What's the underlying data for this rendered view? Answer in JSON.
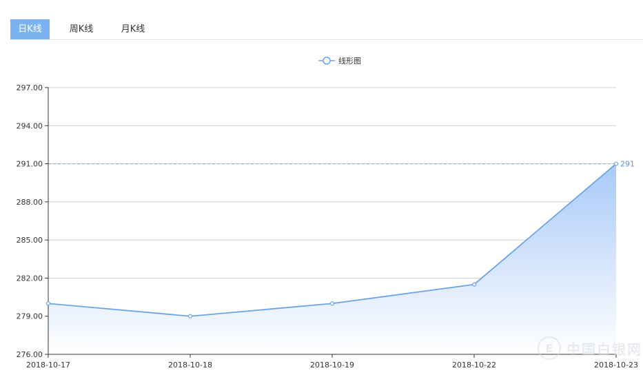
{
  "tabs": [
    {
      "label": "日K线",
      "active": true
    },
    {
      "label": "周K线",
      "active": false
    },
    {
      "label": "月K线",
      "active": false
    }
  ],
  "legend": {
    "label": "线形图",
    "icon": "circle-line-icon"
  },
  "watermark": {
    "text": "中国白银网",
    "icon": "logo-icon"
  },
  "colors": {
    "line": "#6aa3ea",
    "area_top": "#a8c9f8",
    "area_bottom": "#ffffff",
    "markline": "#7aa9dc",
    "active_tab": "#7ab3ef"
  },
  "chart_data": {
    "type": "area",
    "categories": [
      "2018-10-17",
      "2018-10-18",
      "2018-10-19",
      "2018-10-22",
      "2018-10-23"
    ],
    "series": [
      {
        "name": "线形图",
        "values": [
          280,
          279,
          280,
          281.5,
          291
        ]
      }
    ],
    "ylim": [
      276,
      297
    ],
    "yticks": [
      276,
      279,
      282,
      285,
      288,
      291,
      294,
      297
    ],
    "ytick_labels": [
      "276.00",
      "279.00",
      "282.00",
      "285.00",
      "288.00",
      "291.00",
      "294.00",
      "297.00"
    ],
    "markline": {
      "value": 291,
      "label": "291"
    },
    "grid": true,
    "legend_position": "top-center"
  }
}
